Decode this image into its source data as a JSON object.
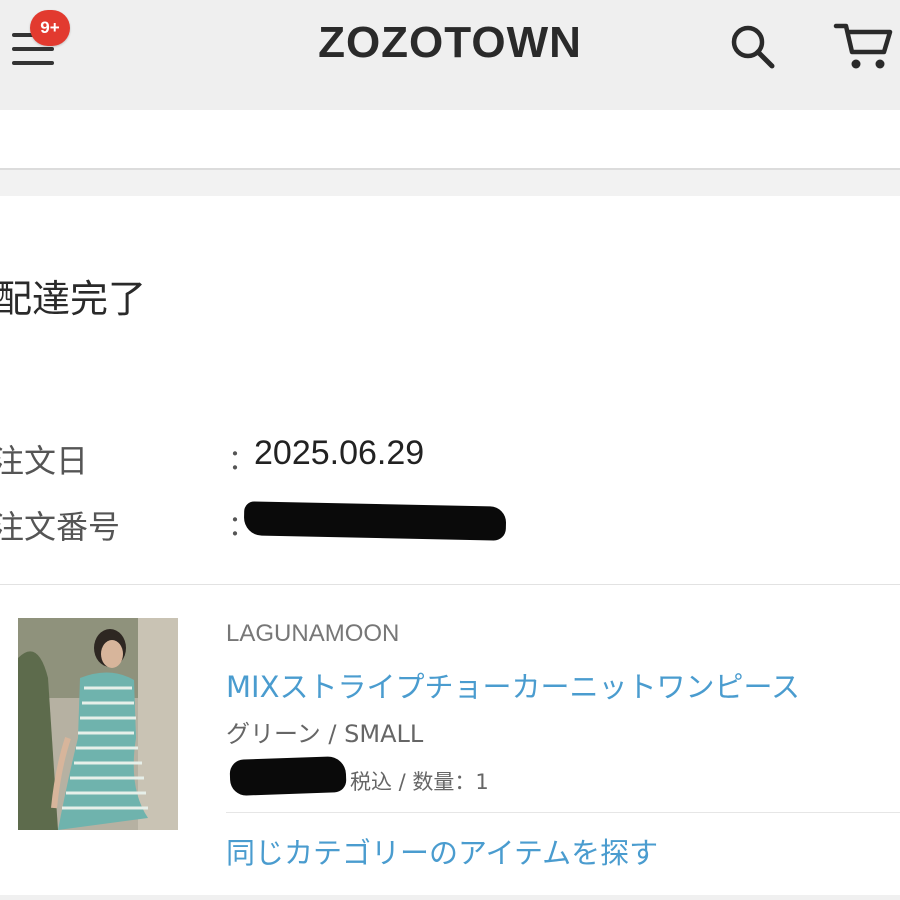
{
  "header": {
    "menu_badge": "9+",
    "logo": "ZOZOTOWN",
    "icons": {
      "menu": "hamburger-menu-icon",
      "search": "search-icon",
      "cart": "cart-icon"
    },
    "badge_color": "#e23a2f"
  },
  "order": {
    "status": "配達完了",
    "order_date_label": "注文日",
    "order_date": "2025.06.29",
    "order_number_label": "注文番号",
    "separator": "："
  },
  "item": {
    "brand": "LAGUNAMOON",
    "name": "MIXストライプチョーカーニットワンピース",
    "variant": "グリーン / SMALL",
    "price_suffix": "税込 / 数量：1",
    "link_color": "#4a9ccf"
  },
  "actions": {
    "similar_items": "同じカテゴリーのアイテムを探す"
  }
}
